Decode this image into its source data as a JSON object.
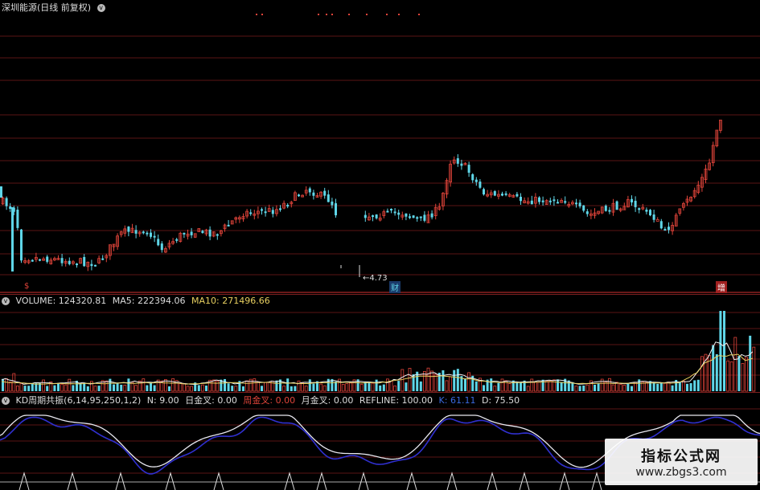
{
  "main": {
    "title": "深圳能源(日线 前复权)",
    "menu_glyph": "v",
    "low_marker": "←4.73",
    "event_cai": "财",
    "event_zeng": "增",
    "event_s": "$"
  },
  "volume": {
    "label": "VOLUME:",
    "value": "124320.81",
    "ma5_label": "MA5:",
    "ma5": "222394.06",
    "ma10_label": "MA10:",
    "ma10": "271496.66"
  },
  "kd": {
    "name": "KD周期共振(6,14,95,250,1,2)",
    "n_label": "N:",
    "n": "9.00",
    "day_label": "日金叉:",
    "day": "0.00",
    "week_label": "周金叉:",
    "week": "0.00",
    "month_label": "月金叉:",
    "month": "0.00",
    "refline_label": "REFLINE:",
    "refline": "100.00",
    "k_label": "K:",
    "k": "61.11",
    "d_label": "D:",
    "d": "75.50"
  },
  "watermark": {
    "title": "指标公式网",
    "url": "www.zbgs3.com"
  },
  "colors": {
    "up": "#e0443a",
    "down": "#5fd6e8",
    "grid": "#5a1414",
    "ma5": "#f0f0f0",
    "ma10": "#e8d060",
    "kline": "#e8e8f0",
    "dline": "#3030d0"
  }
}
